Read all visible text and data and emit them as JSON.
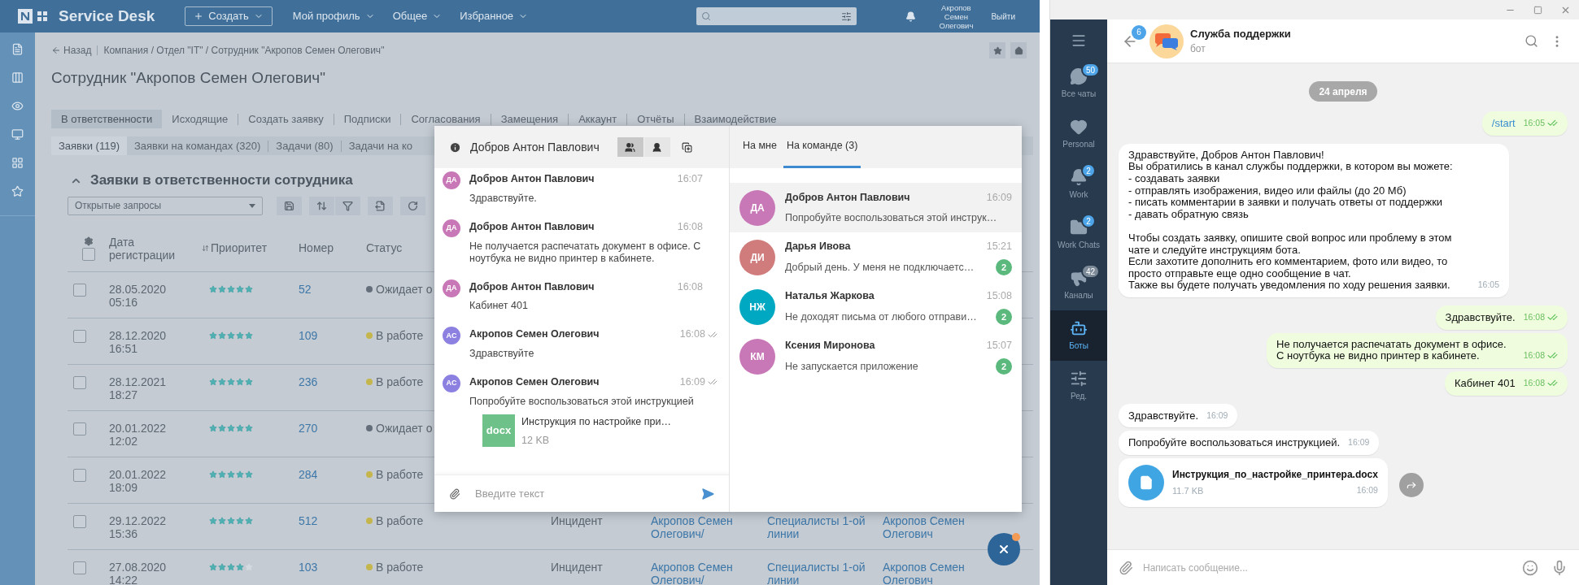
{
  "service_desk": {
    "topbar": {
      "brand": "Service Desk",
      "create_button": "Создать",
      "menus": [
        "Мой профиль",
        "Общее",
        "Избранное"
      ],
      "user": "Акропов Семен Олегович",
      "logout": "Выйти"
    },
    "breadcrumb": {
      "back": "Назад",
      "path": "Компания / Отдел \"IT\" / Сотрудник \"Акропов Семен Олегович\""
    },
    "title": "Сотрудник \"Акропов Семен Олегович\"",
    "tabs": [
      {
        "label": "В ответственности",
        "selected": true
      },
      {
        "label": "Исходящие",
        "selected": false
      },
      {
        "label": "Создать заявку",
        "selected": false
      },
      {
        "label": "Подписки",
        "selected": false
      },
      {
        "label": "Согласования",
        "selected": false
      },
      {
        "label": "Замещения",
        "selected": false
      },
      {
        "label": "Аккаунт",
        "selected": false
      },
      {
        "label": "Отчёты",
        "selected": false
      },
      {
        "label": "Взаимодействие",
        "selected": false
      }
    ],
    "subtabs": [
      {
        "label": "Заявки (119)",
        "selected": true
      },
      {
        "label": "Заявки на командах (320)",
        "selected": false
      },
      {
        "label": "Задачи (80)",
        "selected": false
      },
      {
        "label": "Задачи на ко",
        "selected": false
      }
    ],
    "section_title": "Заявки в ответственности сотрудника",
    "filter": {
      "value": "Открытые запросы"
    },
    "table": {
      "all_checked": false,
      "columns": [
        "Дата регистрации",
        "Приоритет",
        "Номер",
        "Статус"
      ],
      "rows": [
        {
          "checked": false,
          "date": "28.05.2020",
          "time": "05:16",
          "stars": 5,
          "number": "52",
          "status": "Ожидает о",
          "color": "#646e7a"
        },
        {
          "checked": false,
          "date": "28.12.2020",
          "time": "16:51",
          "stars": 5,
          "number": "109",
          "status": "В работе",
          "color": "#c4b64c"
        },
        {
          "checked": false,
          "date": "28.12.2021",
          "time": "18:27",
          "stars": 5,
          "number": "236",
          "status": "В работе",
          "color": "#c4b64c"
        },
        {
          "checked": false,
          "date": "20.01.2022",
          "time": "12:02",
          "stars": 5,
          "number": "270",
          "status": "Ожидает о",
          "color": "#646e7a"
        },
        {
          "checked": false,
          "date": "20.01.2022",
          "time": "18:09",
          "stars": 5,
          "number": "284",
          "status": "В работе",
          "color": "#c4b64c"
        },
        {
          "checked": false,
          "date": "29.12.2022",
          "time": "15:36",
          "stars": 5,
          "number": "512",
          "status": "В работе",
          "color": "#c4b64c",
          "type": "Инцидент",
          "initiator": "Акропов Семен Олегович/",
          "group": "Специалисты 1-ой линии",
          "responsible": "Акропов Семен Олегович"
        },
        {
          "checked": false,
          "date": "27.08.2020",
          "time": "14:22",
          "stars": 4,
          "number": "103",
          "status": "В работе",
          "color": "#c4b64c",
          "type": "Инцидент",
          "initiator": "Акропов Семен Олегович/",
          "group": "Специалисты 1-ой линии",
          "responsible": "Акропов Семен Олегович"
        }
      ]
    }
  },
  "chat": {
    "contact": "Добров Антон Павлович",
    "view_modes": [
      {
        "kind": "team",
        "selected": true
      },
      {
        "kind": "personal",
        "selected": false
      }
    ],
    "messages": [
      {
        "initials": "ДА",
        "color": "#c878b6",
        "author": "Добров Антон Павлович",
        "time": "16:07",
        "text": "Здравствуйте.",
        "read": false
      },
      {
        "initials": "ДА",
        "color": "#c878b6",
        "author": "Добров Антон Павлович",
        "time": "16:08",
        "text": "Не получается распечатать документ в офисе. С ноутбука не видно принтер в кабинете.",
        "read": false
      },
      {
        "initials": "ДА",
        "color": "#c878b6",
        "author": "Добров Антон Павлович",
        "time": "16:08",
        "text": "Кабинет 401",
        "read": false
      },
      {
        "initials": "АС",
        "color": "#8c80e0",
        "author": "Акропов Семен Олегович",
        "time": "16:08",
        "text": "Здравствуйте",
        "read": true
      },
      {
        "initials": "АС",
        "color": "#8c80e0",
        "author": "Акропов Семен Олегович",
        "time": "16:09",
        "text": "Попробуйте воспользоваться этой инструкцией",
        "read": true,
        "attachment": {
          "type": "docx",
          "name": "Инструкция по настройке при…",
          "size": "12 KB"
        }
      }
    ],
    "input": {
      "placeholder": "Введите текст"
    },
    "list_tabs": [
      {
        "label": "На мне",
        "selected": false
      },
      {
        "label": "На команде (3)",
        "selected": true
      }
    ],
    "conversations": [
      {
        "initials": "ДА",
        "color": "#c878b6",
        "name": "Добров Антон Павлович",
        "time": "16:09",
        "preview": "Попробуйте воспользоваться этой инструк…",
        "selected": true
      },
      {
        "initials": "ДИ",
        "color": "#d07c7c",
        "name": "Дарья Ивова",
        "time": "15:21",
        "preview": "Добрый день. У меня не подключаетс…",
        "unread": "2",
        "selected": false
      },
      {
        "initials": "НЖ",
        "color": "#00a9c1",
        "name": "Наталья Жаркова",
        "time": "15:08",
        "preview": "Не доходят письма от любого отправи…",
        "unread": "2",
        "selected": false
      },
      {
        "initials": "КМ",
        "color": "#c878b6",
        "name": "Ксения Миронова",
        "time": "15:07",
        "preview": "Не запускается приложение",
        "unread": "2",
        "selected": false
      }
    ]
  },
  "telegram": {
    "folders": [
      {
        "kind": "chats",
        "label": "Все чаты",
        "badge": {
          "count": "50",
          "muted": false
        },
        "selected": false
      },
      {
        "kind": "heart",
        "label": "Personal",
        "selected": false
      },
      {
        "kind": "bell",
        "label": "Work",
        "badge": {
          "count": "2",
          "muted": false
        },
        "selected": false
      },
      {
        "kind": "folder",
        "label": "Work Chats",
        "badge": {
          "count": "2",
          "muted": false
        },
        "selected": false
      },
      {
        "kind": "megaphone",
        "label": "Каналы",
        "badge": {
          "count": "42",
          "muted": true
        },
        "selected": false
      },
      {
        "kind": "bot",
        "label": "Боты",
        "selected": true
      },
      {
        "kind": "edit",
        "label": "Ред.",
        "selected": false
      }
    ],
    "back_badge": "6",
    "title": "Служба поддержки",
    "subtitle": "бот",
    "date": "24 апреля",
    "messages": [
      {
        "kind": "command",
        "out": true,
        "text": "/start",
        "time": "16:05",
        "read": true
      },
      {
        "kind": "text",
        "out": false,
        "text": "Здравствуйте, Добров Антон Павлович!\nВы обратились в канал службы поддержки, в котором вы можете:\n- создавать заявки\n- отправлять изображения, видео или файлы (до 20 Мб)\n- писать комментарии в заявки и получать ответы от поддержки\n- давать обратную связь\n\nЧтобы создать заявку, опишите свой вопрос или проблему в этом чате и следуйте инструкциям бота.\nЕсли захотите дополнить его комментарием, фото или видео, то просто отправьте еще одно сообщение в чат.\nТакже вы будете получать уведомления по ходу решения заявки.",
        "time": "16:05",
        "read": false
      },
      {
        "kind": "text",
        "out": true,
        "text": "Здравствуйте.",
        "time": "16:08",
        "read": true
      },
      {
        "kind": "text",
        "out": true,
        "text": "Не получается распечатать документ в офисе. С ноутбука не видно принтер в кабинете.",
        "time": "16:08",
        "read": true
      },
      {
        "kind": "text",
        "out": true,
        "text": "Кабинет 401",
        "time": "16:08",
        "read": true
      },
      {
        "kind": "text",
        "out": false,
        "text": "Здравствуйте.",
        "time": "16:09",
        "read": false
      },
      {
        "kind": "text",
        "out": false,
        "text": "Попробуйте воспользоваться инструкцией.",
        "time": "16:09",
        "read": false
      },
      {
        "kind": "file",
        "out": false,
        "name": "Инструкция_по_настройке_принтера.docx",
        "size": "11.7 KB",
        "time": "16:09",
        "read": false
      }
    ],
    "input": {
      "placeholder": "Написать сообщение..."
    }
  }
}
